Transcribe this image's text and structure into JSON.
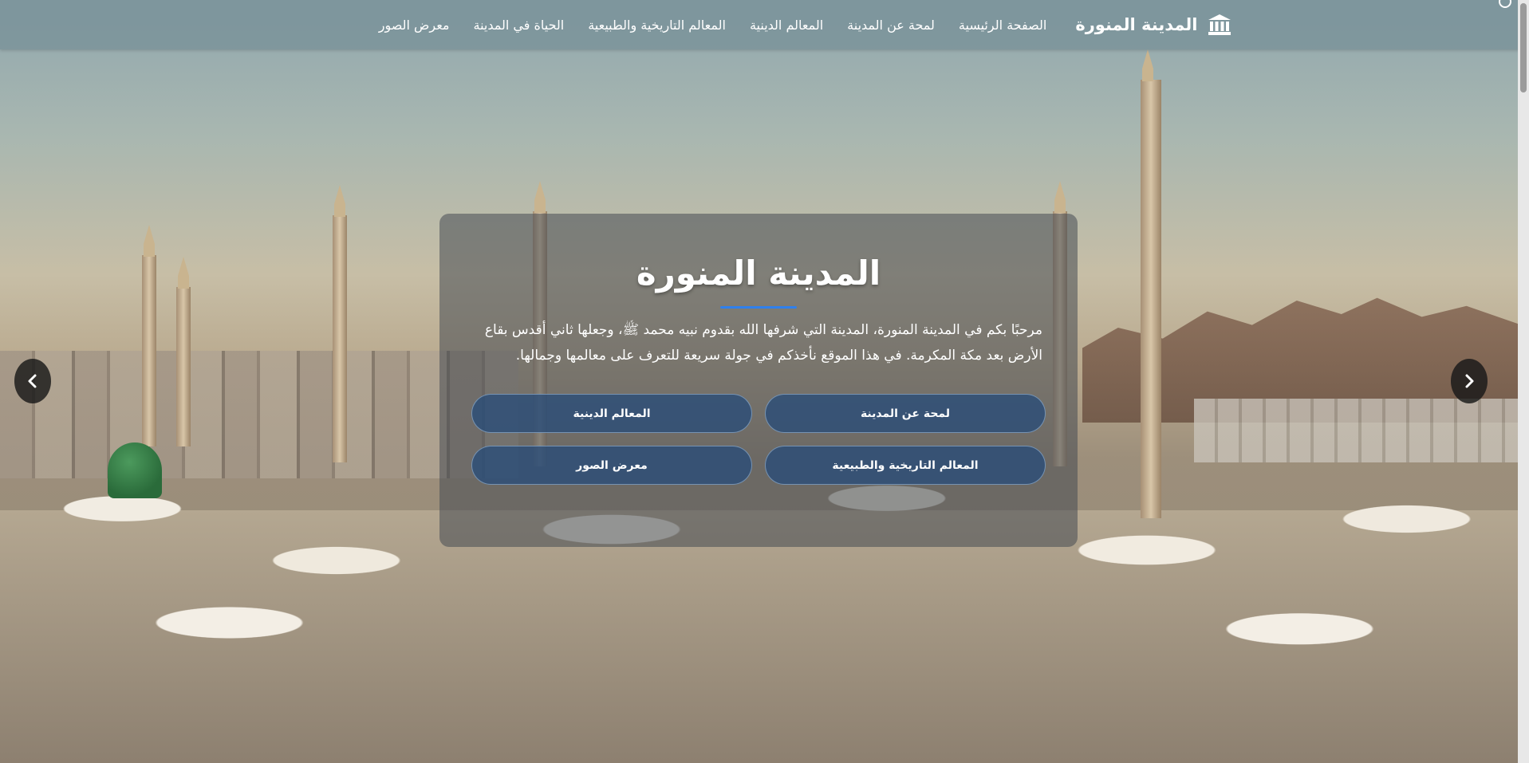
{
  "navbar": {
    "brand_label": "المدينة المنورة",
    "brand_icon": "landmark-icon",
    "links": [
      {
        "label": "الصفحة الرئيسية"
      },
      {
        "label": "لمحة عن المدينة"
      },
      {
        "label": "المعالم الدينية"
      },
      {
        "label": "المعالم التاريخية والطبيعية"
      },
      {
        "label": "الحياة في المدينة"
      },
      {
        "label": "معرض الصور"
      }
    ]
  },
  "hero": {
    "title": "المدينة المنورة",
    "description": "مرحبًا بكم في المدينة المنورة، المدينة التي شرفها الله بقدوم نبيه محمد ﷺ، وجعلها ثاني أقدس بقاع الأرض بعد مكة المكرمة. في هذا الموقع نأخذكم في جولة سريعة للتعرف على معالمها وجمالها.",
    "buttons": [
      {
        "label": "لمحة عن المدينة"
      },
      {
        "label": "المعالم الدينية"
      },
      {
        "label": "المعالم التاريخية والطبيعية"
      },
      {
        "label": "معرض الصور"
      }
    ]
  },
  "carousel": {
    "prev_icon": "chevron-left-icon",
    "next_icon": "chevron-right-icon"
  },
  "colors": {
    "accent_underline": "#2f80ed",
    "button_bg": "#284b78"
  }
}
